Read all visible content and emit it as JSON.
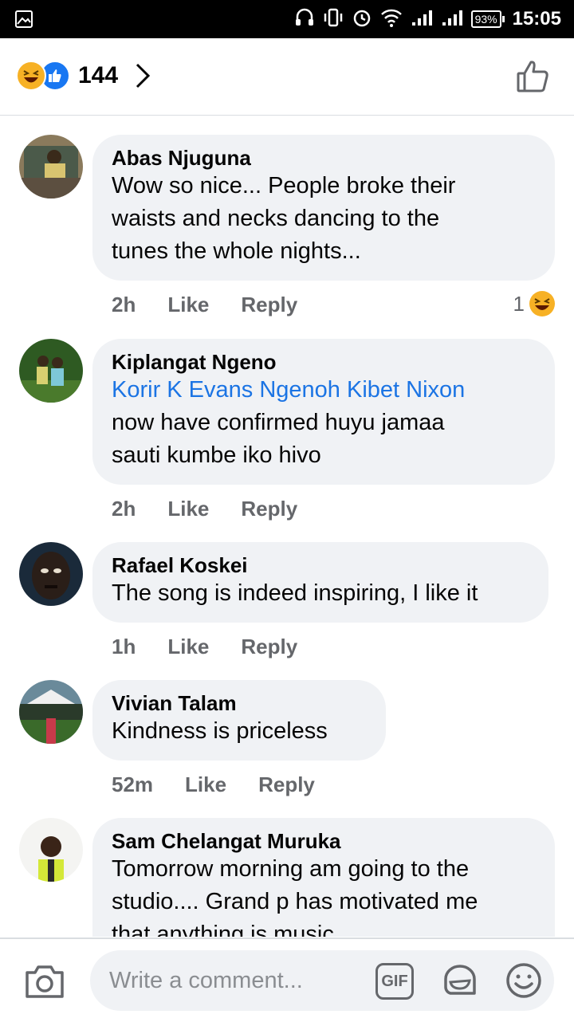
{
  "status_bar": {
    "time": "15:05",
    "battery": "93%",
    "icons": [
      "gallery-icon",
      "headset-icon",
      "vibrate-icon",
      "alarm-icon",
      "wifi-icon",
      "signal-icon",
      "signal-icon"
    ]
  },
  "header": {
    "reaction_count": "144",
    "reactions": [
      "haha-icon",
      "like-icon"
    ]
  },
  "comments": [
    {
      "author": "Abas Njuguna",
      "lines": [
        "Wow so nice... People broke their",
        "waists and necks dancing to the",
        "tunes the whole nights..."
      ],
      "time": "2h",
      "like": "Like",
      "reply": "Reply",
      "reaction_count": "1"
    },
    {
      "author": "Kiplangat Ngeno",
      "mention": "Korir K Evans Ngenoh Kibet Nixon",
      "lines": [
        "now have confirmed huyu jamaa",
        "sauti kumbe iko hivo"
      ],
      "time": "2h",
      "like": "Like",
      "reply": "Reply"
    },
    {
      "author": "Rafael Koskei",
      "lines": [
        "The song is indeed inspiring, I like it"
      ],
      "time": "1h",
      "like": "Like",
      "reply": "Reply"
    },
    {
      "author": "Vivian Talam",
      "lines": [
        "Kindness is priceless"
      ],
      "time": "52m",
      "like": "Like",
      "reply": "Reply"
    },
    {
      "author": "Sam Chelangat Muruka",
      "lines": [
        "Tomorrow morning am going to the",
        "studio.... Grand p has motivated me",
        "that anything is music"
      ]
    }
  ],
  "composer": {
    "placeholder": "Write a comment...",
    "gif_label": "GIF"
  },
  "colors": {
    "accent": "#1877f2",
    "mention": "#1b74e4",
    "bubble": "#f0f2f5",
    "secondary_text": "#65676b"
  }
}
